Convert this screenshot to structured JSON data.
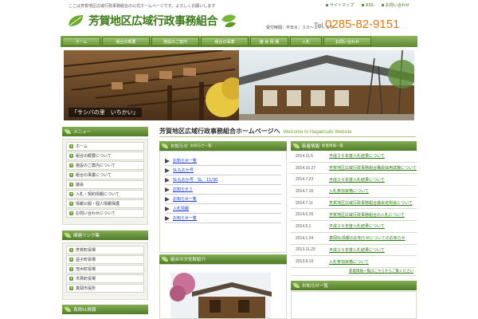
{
  "header": {
    "tagline": "ここは芳賀地区広域行政事務組合の公式ホームページです。よろしくお願いします",
    "top_links": [
      "サイトマップ",
      "RSS",
      "お問い合わせ"
    ],
    "logo_text": "芳賀地区広域行政事務組合",
    "hours": "受付時間：平日８：３０〜１７：１５",
    "tel_prefix": "Tel.",
    "tel_number": "0285-82-9151"
  },
  "nav": [
    "ホーム",
    "組合の概要",
    "施設のご案内",
    "組合の事業",
    "議 会 情 報",
    "入札",
    "お問い合わせ"
  ],
  "hero": {
    "caption": "「サシバの里　いちかい」"
  },
  "sidebar": {
    "menu_title": "メニュー",
    "menu_items": [
      "ホーム",
      "組合の概要について",
      "施設のご案内について",
      "組合の事業について",
      "議会",
      "入札・契約情報について",
      "情報公開・個人情報保護",
      "お問い合わせについて"
    ],
    "section2_title": "関連リンク集",
    "section2_items": [
      "芳賀町役場",
      "益子町役場",
      "茂木町役場",
      "市貝町役場",
      "真岡市役所"
    ],
    "section3_title": "真岡SL情報"
  },
  "main": {
    "title_ja": "芳賀地区広域行政事務組合ホームページへ",
    "title_en": "Welcome to Hagakouiki Website",
    "notice_title": "お知らせ",
    "notice_sub": "お知らせ一覧",
    "notice_items": [
      "お知らせ一覧",
      "SLもおか号",
      "SLもおか号　SL　11/30",
      "お知らせ３",
      "お知らせ一覧",
      "入札情報",
      "お知らせ一覧"
    ],
    "news_title": "新着情報",
    "news_sub": "新着情報一覧",
    "news": [
      {
        "date": "2014.11.5",
        "title": "平成２６年度入札結果について"
      },
      {
        "date": "2014.10.27",
        "title": "芳賀地区広域行政事務組合職員採用試験について"
      },
      {
        "date": "2014.7.23",
        "title": "平成２６年度入札結果について"
      },
      {
        "date": "2014.7.16",
        "title": "入札参加資格について"
      },
      {
        "date": "2014.7.11",
        "title": "芳賀地区広域行政事務組合議会定例会について"
      },
      {
        "date": "2014.6.26",
        "title": "芳賀地区広域行政事務組合の入札について"
      },
      {
        "date": "2014.5.1",
        "title": "平成２６年度入札結果について"
      },
      {
        "date": "2014.1.24",
        "title": "真岡SL情報のお知らせについてのお知らせ"
      },
      {
        "date": "2013.11.29",
        "title": "平成２５年度入札結果について"
      },
      {
        "date": "2013.8.19",
        "title": "入札参加資格について"
      }
    ],
    "news_more": "新着情報一覧はこちらからご覧ください",
    "photo_title": "組合の文化財紹介",
    "bottom_right_title": "お知らせ一覧"
  },
  "colors": {
    "green": "#5d8a30",
    "orange": "#e07a10",
    "link_blue": "#1a3ad8"
  }
}
